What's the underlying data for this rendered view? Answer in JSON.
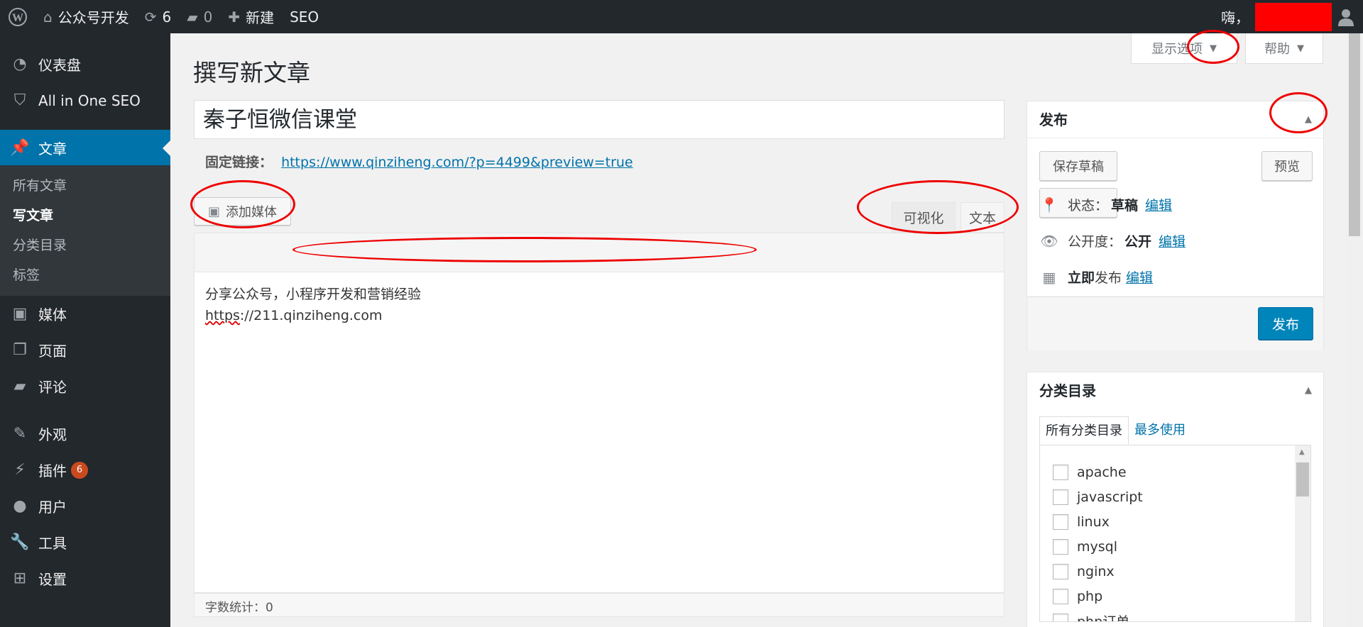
{
  "adminbar": {
    "site_name": "公众号开发",
    "updates_count": "6",
    "comments_count": "0",
    "new_label": "新建",
    "seo_label": "SEO",
    "greeting": "嗨，"
  },
  "sidebar": {
    "dashboard": "仪表盘",
    "aioseo": "All in One SEO",
    "posts": "文章",
    "posts_sub": [
      "所有文章",
      "写文章",
      "分类目录",
      "标签"
    ],
    "media": "媒体",
    "pages": "页面",
    "comments": "评论",
    "appearance": "外观",
    "plugins": "插件",
    "plugins_badge": "6",
    "users": "用户",
    "tools": "工具",
    "settings": "设置"
  },
  "header": {
    "screen_options": "显示选项",
    "help": "帮助",
    "title": "撰写新文章"
  },
  "editor": {
    "post_title": "秦子恒微信课堂",
    "permalink_label": "固定链接：",
    "permalink_url": "https://www.qinziheng.com/?p=4499&preview=true",
    "add_media": "添加媒体",
    "tab_visual": "可视化",
    "tab_text": "文本",
    "content_line1": "分享公众号，小程序开发和营销经验",
    "content_line2_a": "https",
    "content_line2_b": "://211.qinziheng.com",
    "word_count": "字数统计：0"
  },
  "publish": {
    "title": "发布",
    "save_draft": "保存草稿",
    "preview": "预览",
    "status_label": "状态：",
    "status_value": "草稿",
    "visibility_label": "公开度：",
    "visibility_value": "公开",
    "schedule_bold": "立即",
    "schedule_rest": "发布",
    "edit": "编辑",
    "publish_button": "发布"
  },
  "categories": {
    "title": "分类目录",
    "tab_all": "所有分类目录",
    "tab_popular": "最多使用",
    "items": [
      "apache",
      "javascript",
      "linux",
      "mysql",
      "nginx",
      "php",
      "php订单"
    ]
  },
  "colors": {
    "adminbar_bg": "#23282d",
    "accent": "#0073aa",
    "publish_btn": "#0085ba",
    "annotation": "#e00000"
  }
}
